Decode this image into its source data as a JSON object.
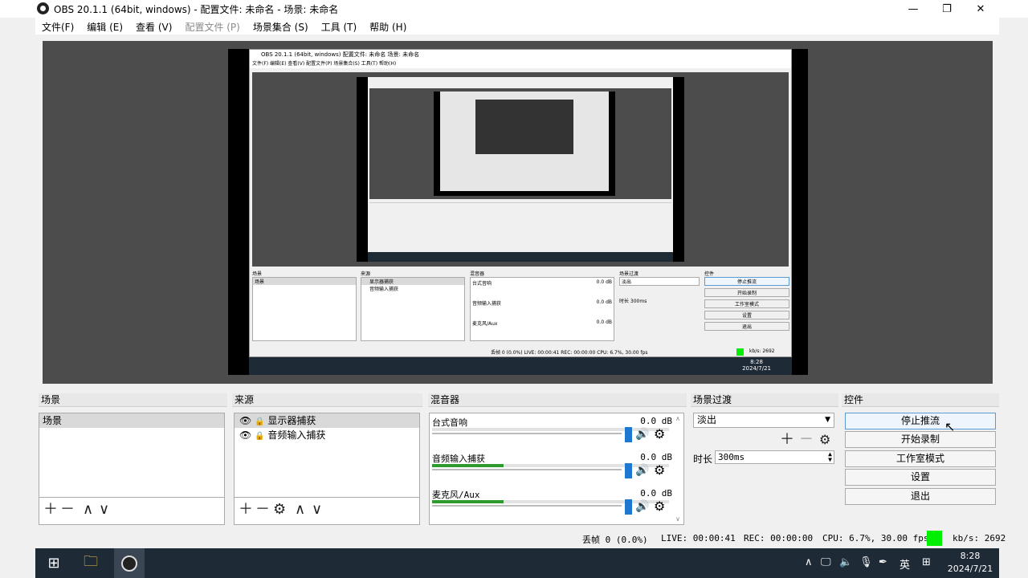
{
  "window": {
    "title": "OBS 20.1.1 (64bit, windows) - 配置文件: 未命名 - 场景: 未命名",
    "controls": {
      "minimize": "—",
      "restore": "❐",
      "close": "✕"
    }
  },
  "menu": [
    {
      "label": "文件(F)",
      "disabled": false
    },
    {
      "label": "编辑 (E)",
      "disabled": false
    },
    {
      "label": "查看 (V)",
      "disabled": false
    },
    {
      "label": "配置文件 (P)",
      "disabled": true
    },
    {
      "label": "场景集合 (S)",
      "disabled": false
    },
    {
      "label": "工具 (T)",
      "disabled": false
    },
    {
      "label": "帮助 (H)",
      "disabled": false
    }
  ],
  "docks": {
    "scenes": {
      "title": "场景",
      "items": [
        "场景"
      ],
      "selected": 0
    },
    "sources": {
      "title": "来源",
      "items": [
        "显示器捕获",
        "音频输入捕获"
      ],
      "selected": 0
    },
    "mixer": {
      "title": "混音器",
      "channels": [
        {
          "name": "台式音响",
          "db": "0.0 dB",
          "level": 0.0
        },
        {
          "name": "音频输入捕获",
          "db": "0.0 dB",
          "level": 0.3
        },
        {
          "name": "麦克风/Aux",
          "db": "0.0 dB",
          "level": 0.3
        }
      ]
    },
    "transitions": {
      "title": "场景过渡",
      "selected": "淡出",
      "duration_label": "时长",
      "duration_value": "300ms"
    },
    "controls": {
      "title": "控件",
      "buttons": [
        "停止推流",
        "开始录制",
        "工作室模式",
        "设置",
        "退出"
      ]
    }
  },
  "status": {
    "dropped": "丢帧 0 (0.0%)",
    "live": "LIVE: 00:00:41",
    "rec": "REC: 00:00:00",
    "cpu": "CPU: 6.7%, 30.00 fps",
    "kbps": "kb/s: 2692",
    "indicator_color": "#00ee00"
  },
  "taskbar": {
    "time": "8:28",
    "date": "2024/7/21",
    "ime": "英",
    "tray_icons": [
      "chevron-up-icon",
      "network-icon",
      "speaker-icon",
      "mic-icon",
      "pen-icon",
      "ime-icon",
      "keyboard-icon"
    ],
    "apps": [
      "windows-start-icon",
      "file-explorer-icon",
      "obs-icon"
    ]
  },
  "preview_nested": {
    "title": "OBS 20.1.1 (64bit, windows)   配置文件: 未命名   场景: 未命名",
    "menu": "文件(F)  编辑(E)  查看(V)  配置文件(P)  场景集合(S)  工具(T)  帮助(H)",
    "docks": [
      "场景",
      "来源",
      "混音器",
      "场景过渡",
      "控件"
    ],
    "scene_item": "场景",
    "sources": [
      "显示器捕获",
      "音频输入捕获"
    ],
    "mixer": [
      "台式音响",
      "音频输入捕获",
      "麦克风/Aux"
    ],
    "db": "0.0 dB",
    "transition": "淡出",
    "duration": "时长  300ms",
    "buttons": [
      "停止推流",
      "开始录制",
      "工作室模式",
      "设置",
      "退出"
    ],
    "status": "丢帧 0 (0.0%)   LIVE: 00:00:41   REC: 00:00:00   CPU: 6.7%, 30.00 fps",
    "kbps": "kb/s: 2692",
    "time": "8:28",
    "date": "2024/7/21"
  }
}
